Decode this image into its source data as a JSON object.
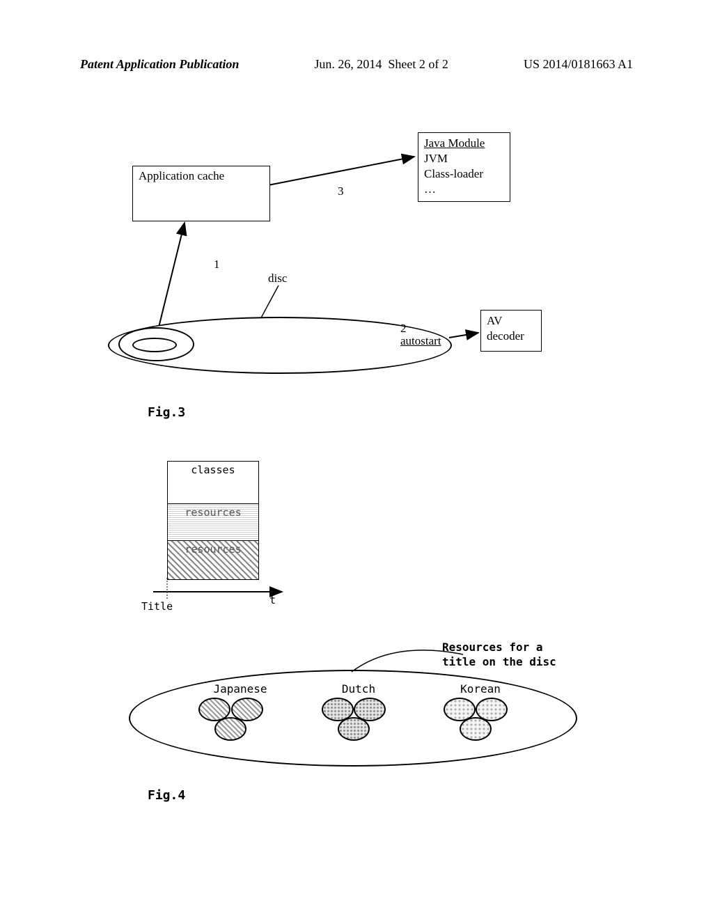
{
  "header": {
    "left": "Patent Application Publication",
    "date": "Jun. 26, 2014",
    "sheet": "Sheet 2 of 2",
    "pubno": "US 2014/0181663 A1"
  },
  "fig3": {
    "app_cache": "Application cache",
    "java_module_title": "Java Module",
    "java_module_line1": "JVM",
    "java_module_line2": "Class-loader",
    "java_module_line3": "…",
    "num1": "1",
    "num3": "3",
    "disc_label": "disc",
    "num2": "2",
    "autostart": "autostart",
    "av_line1": "AV",
    "av_line2": "decoder",
    "caption": "Fig.3"
  },
  "fig4": {
    "stack_classes": "classes",
    "stack_res1": "resources",
    "stack_res2": "resources",
    "title_label": "Title",
    "t_label": "t",
    "resources_for_line1": "Resources for a",
    "resources_for_line2": "title on the disc",
    "lang1": "Japanese",
    "lang2": "Dutch",
    "lang3": "Korean",
    "caption": "Fig.4"
  }
}
